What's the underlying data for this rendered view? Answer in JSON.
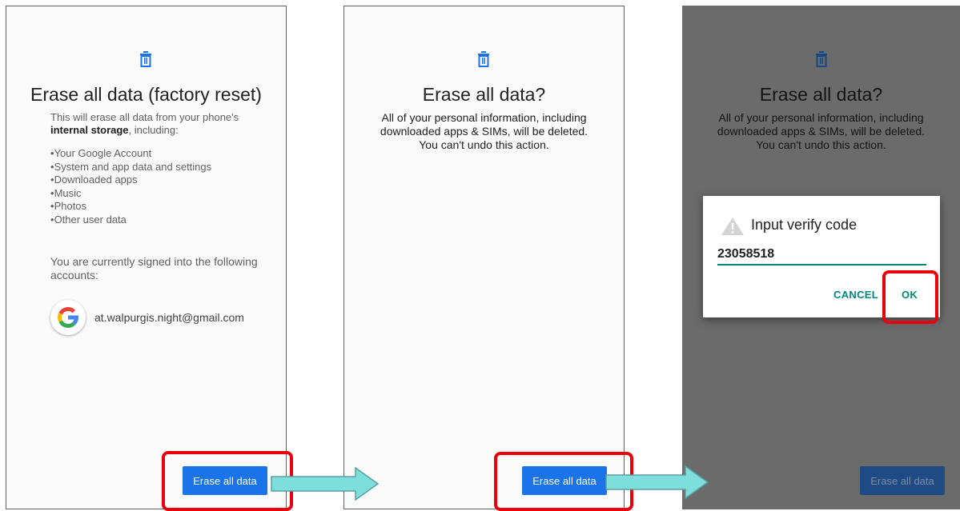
{
  "screens": [
    {
      "title": "Erase all data (factory reset)",
      "intro_line1": "This will erase all data from your phone's",
      "intro_bold": "internal storage",
      "intro_rest": ", including:",
      "items": [
        "Your Google Account",
        "System and app data and settings",
        "Downloaded apps",
        "Music",
        "Photos",
        "Other user data"
      ],
      "accounts_text": "You are currently signed into the following accounts:",
      "account_email": "at.walpurgis.night@gmail.com",
      "button_label": "Erase all data"
    },
    {
      "title": "Erase all data?",
      "body_line1": "All of your personal information, including",
      "body_line2": "downloaded apps & SIMs, will be deleted.",
      "body_line3": "You can't undo this action.",
      "button_label": "Erase all data"
    },
    {
      "title": "Erase all data?",
      "body_line1": "All of your personal information, including",
      "body_line2": "downloaded apps & SIMs, will be deleted.",
      "body_line3": "You can't undo this action.",
      "button_label": "Erase all data",
      "dialog": {
        "title": "Input verify code",
        "input_value": "23058518",
        "cancel_label": "CANCEL",
        "ok_label": "OK"
      }
    }
  ],
  "icons": {
    "trash": "trash-icon",
    "google": "google-icon",
    "warning": "warning-icon",
    "arrow": "arrow-right-icon"
  },
  "colors": {
    "accent_blue": "#1a73e8",
    "dialog_teal": "#00897b",
    "highlight_red": "#e8000a",
    "arrow_fill": "#7ddedc",
    "dim_overlay": "#6b6b6b"
  }
}
